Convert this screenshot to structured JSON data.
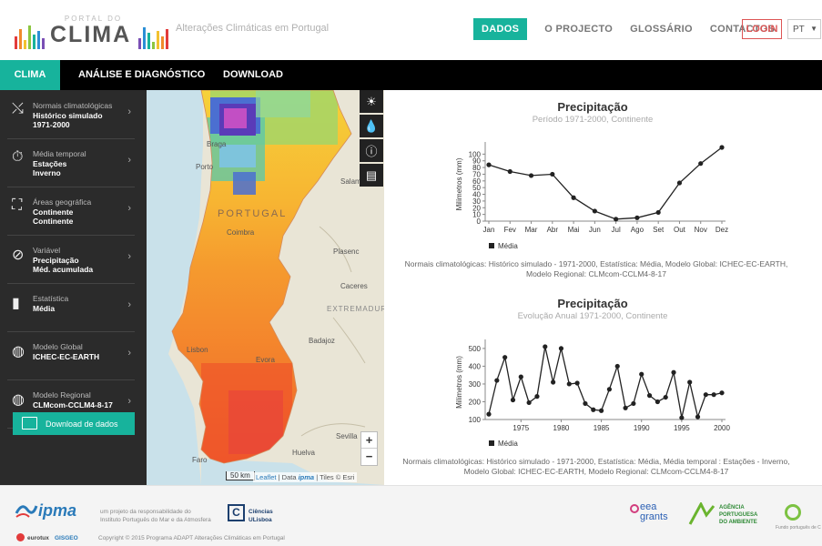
{
  "header": {
    "logo_top": "PORTAL DO",
    "logo_main": "CLIMA",
    "tagline": "Alterações Climáticas em Portugal",
    "nav": [
      "DADOS",
      "O PROJECTO",
      "GLOSSÁRIO",
      "CONTACTOS"
    ],
    "login": "LOGIN",
    "lang": "PT",
    "bar_colors": [
      "#e23b3b",
      "#f08a2c",
      "#f2c230",
      "#8cc63f",
      "#17b39c",
      "#2b8fd6",
      "#7a4fb5"
    ]
  },
  "tabs": [
    "CLIMA",
    "ANÁLISE E DIAGNÓSTICO",
    "DOWNLOAD"
  ],
  "sidebar": {
    "items": [
      {
        "icon": "trend-icon",
        "label": "Normais climatológicas",
        "v1": "Histórico simulado",
        "v2": "1971-2000"
      },
      {
        "icon": "stopwatch-icon",
        "label": "Média temporal",
        "v1": "Estações",
        "v2": "Inverno"
      },
      {
        "icon": "map-icon",
        "label": "Áreas geográfica",
        "v1": "Continente",
        "v2": "Continente"
      },
      {
        "icon": "compass-icon",
        "label": "Variável",
        "v1": "Precipitação",
        "v2": "Méd. acumulada"
      },
      {
        "icon": "bar-chart-icon",
        "label": "Estatística",
        "v1": "Média",
        "v2": ""
      },
      {
        "icon": "globe-icon",
        "label": "Modelo Global",
        "v1": "ICHEC-EC-EARTH",
        "v2": ""
      },
      {
        "icon": "globe-icon",
        "label": "Modelo Regional",
        "v1": "CLMcom-CCLM4-8-17",
        "v2": ""
      }
    ],
    "download_button": "Download de dados"
  },
  "map": {
    "labels": [
      "Braga",
      "Porto",
      "PORTUGAL",
      "Coimbra",
      "Salam",
      "Plasenc",
      "Caceres",
      "EXTREMADURA",
      "Badajoz",
      "Lisbon",
      "Evora",
      "Huelva",
      "Sevilla",
      "Faro"
    ],
    "scale": "50 km",
    "attribution_link": "Leaflet",
    "attribution_text": "| Data",
    "attribution_tiles": "| Tiles © Esri",
    "zoom_in": "+",
    "zoom_out": "−",
    "tools": [
      "sun-icon",
      "drops-icon",
      "info-icon",
      "legend-icon"
    ]
  },
  "chart1": {
    "title": "Precipitação",
    "subtitle": "Período 1971-2000, Continente",
    "ylabel": "Milímetros (mm)",
    "legend": "Média",
    "note_line1": "Normais climatológicas: Histórico simulado - 1971-2000, Estatística: Média, Modelo Global: ICHEC-EC-EARTH,",
    "note_line2": "Modelo Regional: CLMcom-CCLM4-8-17"
  },
  "chart2": {
    "title": "Precipitação",
    "subtitle": "Evolução Anual 1971-2000, Continente",
    "ylabel": "Milímetros (mm)",
    "legend": "Média",
    "note_line1": "Normais climatológicas: Histórico simulado - 1971-2000, Estatística: Média, Média temporal : Estações - Inverno,",
    "note_line2": "Modelo Global: ICHEC-EC-EARTH, Modelo Regional: CLMcom-CCLM4-8-17"
  },
  "chart_data": [
    {
      "type": "line",
      "title": "Precipitação",
      "subtitle": "Período 1971-2000, Continente",
      "ylabel": "Milímetros (mm)",
      "categories": [
        "Jan",
        "Fev",
        "Mar",
        "Abr",
        "Mai",
        "Jun",
        "Jul",
        "Ago",
        "Set",
        "Out",
        "Nov",
        "Dez"
      ],
      "series": [
        {
          "name": "Média",
          "values": [
            84,
            74,
            68,
            70,
            35,
            15,
            3,
            5,
            13,
            57,
            86,
            110
          ]
        }
      ],
      "ylim": [
        0,
        110
      ],
      "yticks": [
        0,
        10,
        20,
        30,
        40,
        50,
        60,
        70,
        80,
        90,
        100
      ],
      "legend": "bottom-left",
      "grid": false
    },
    {
      "type": "line",
      "title": "Precipitação",
      "subtitle": "Evolução Anual 1971-2000, Continente",
      "ylabel": "Milímetros (mm)",
      "x": [
        1971,
        1972,
        1973,
        1974,
        1975,
        1976,
        1977,
        1978,
        1979,
        1980,
        1981,
        1982,
        1983,
        1984,
        1985,
        1986,
        1987,
        1988,
        1989,
        1990,
        1991,
        1992,
        1993,
        1994,
        1995,
        1996,
        1997,
        1998,
        1999,
        2000
      ],
      "series": [
        {
          "name": "Média",
          "values": [
            130,
            320,
            450,
            210,
            340,
            195,
            230,
            510,
            310,
            500,
            300,
            305,
            190,
            155,
            150,
            270,
            400,
            165,
            190,
            355,
            235,
            200,
            225,
            365,
            110,
            310,
            115,
            240,
            240,
            250
          ]
        }
      ],
      "xticks": [
        1975,
        1980,
        1985,
        1990,
        1995,
        2000
      ],
      "yticks": [
        100,
        200,
        300,
        400,
        500
      ],
      "ylim": [
        100,
        520
      ],
      "legend": "bottom-left",
      "grid": false
    }
  ],
  "footer": {
    "ipma": "ipma",
    "project_text_1": "um projeto da responsabilidade do",
    "project_text_2": "Instituto Português do Mar e da Atmosfera",
    "ciencias_1": "Ciências",
    "ciencias_2": "ULisboa",
    "eurotux": "eurotux",
    "gisgeo": "GISGEO",
    "copyright": "Copyright © 2015 Programa ADAPT Alterações Climáticas em Portugal",
    "eea_1": "eea",
    "eea_2": "grants",
    "apa_1": "AGÊNCIA",
    "apa_2": "PORTUGUESA",
    "apa_3": "DO AMBIENTE",
    "fundo": "Fundo português de C"
  }
}
